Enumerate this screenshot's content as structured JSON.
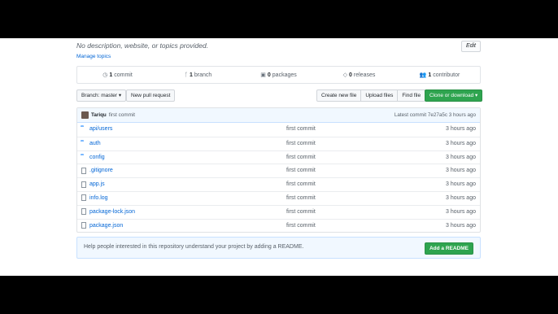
{
  "repo": {
    "description": "No description, website, or topics provided.",
    "edit_label": "Edit",
    "manage_topics_label": "Manage topics"
  },
  "stats": [
    {
      "icon": "commit-icon",
      "glyph": "◷",
      "count": "1",
      "label": "commit"
    },
    {
      "icon": "branch-icon",
      "glyph": "ᚴ",
      "count": "1",
      "label": "branch"
    },
    {
      "icon": "package-icon",
      "glyph": "▣",
      "count": "0",
      "label": "packages"
    },
    {
      "icon": "tag-icon",
      "glyph": "◇",
      "count": "0",
      "label": "releases"
    },
    {
      "icon": "people-icon",
      "glyph": "👥",
      "count": "1",
      "label": "contributor"
    }
  ],
  "toolbar": {
    "branch_label": "Branch: master ▾",
    "new_pr_label": "New pull request",
    "create_file_label": "Create new file",
    "upload_label": "Upload files",
    "find_label": "Find file",
    "clone_label": "Clone or download ▾"
  },
  "commit": {
    "author": "Tariqu",
    "message": "first commit",
    "latest": "Latest commit 7e27a5c 3 hours ago"
  },
  "files": [
    {
      "type": "dir",
      "name": "api/users",
      "message": "first commit",
      "age": "3 hours ago"
    },
    {
      "type": "dir",
      "name": "auth",
      "message": "first commit",
      "age": "3 hours ago"
    },
    {
      "type": "dir",
      "name": "config",
      "message": "first commit",
      "age": "3 hours ago"
    },
    {
      "type": "file",
      "name": ".gitignore",
      "message": "first commit",
      "age": "3 hours ago"
    },
    {
      "type": "file",
      "name": "app.js",
      "message": "first commit",
      "age": "3 hours ago"
    },
    {
      "type": "file",
      "name": "info.log",
      "message": "first commit",
      "age": "3 hours ago"
    },
    {
      "type": "file",
      "name": "package-lock.json",
      "message": "first commit",
      "age": "3 hours ago"
    },
    {
      "type": "file",
      "name": "package.json",
      "message": "first commit",
      "age": "3 hours ago"
    }
  ],
  "readme": {
    "text": "Help people interested in this repository understand your project by adding a README.",
    "button_label": "Add a README"
  }
}
